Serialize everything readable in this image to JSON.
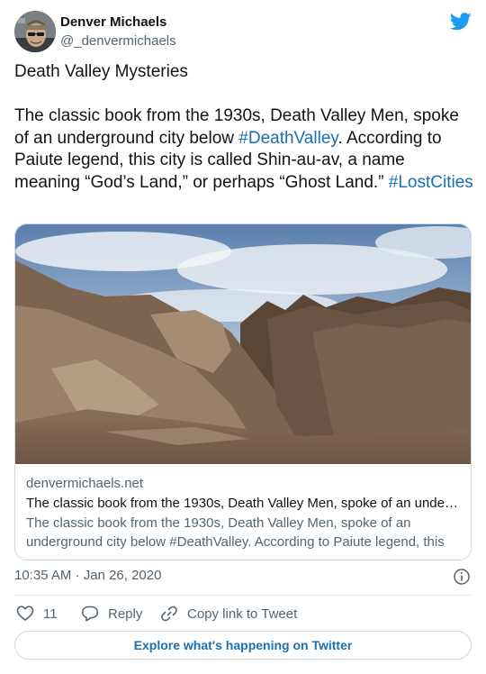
{
  "author": {
    "name": "Denver Michaels",
    "handle": "@_denvermichaels"
  },
  "tweet": {
    "title": "Death Valley Mysteries",
    "text_part1": "The classic book from the 1930s, Death Valley Men, spoke of an underground city below ",
    "hashtag1": "#DeathValley",
    "text_part2": ". According to Paiute legend, this city is called Shin-au-av, a name meaning “God’s Land,” or perhaps “Ghost Land.” ",
    "hashtag2": "#LostCities"
  },
  "card": {
    "domain": "denvermichaels.net",
    "title": "The classic book from the 1930s, Death Valley Men, spoke of an under…",
    "description": "The classic book from the 1930s, Death Valley Men, spoke of an underground city below #DeathValley. According to Paiute legend, this …"
  },
  "timestamp": "10:35 AM · Jan 26, 2020",
  "actions": {
    "like_count": "11",
    "reply_label": "Reply",
    "copy_label": "Copy link to Tweet"
  },
  "explore_label": "Explore what's happening on Twitter",
  "colors": {
    "link": "#1b6fb1",
    "twitter_blue": "#1d9bf0",
    "muted_text": "#536471",
    "border": "#cfd9de"
  },
  "icons": {
    "logo": "twitter-bird-icon",
    "info": "info-icon",
    "like": "heart-icon",
    "reply": "speech-bubble-icon",
    "copy": "link-icon"
  }
}
